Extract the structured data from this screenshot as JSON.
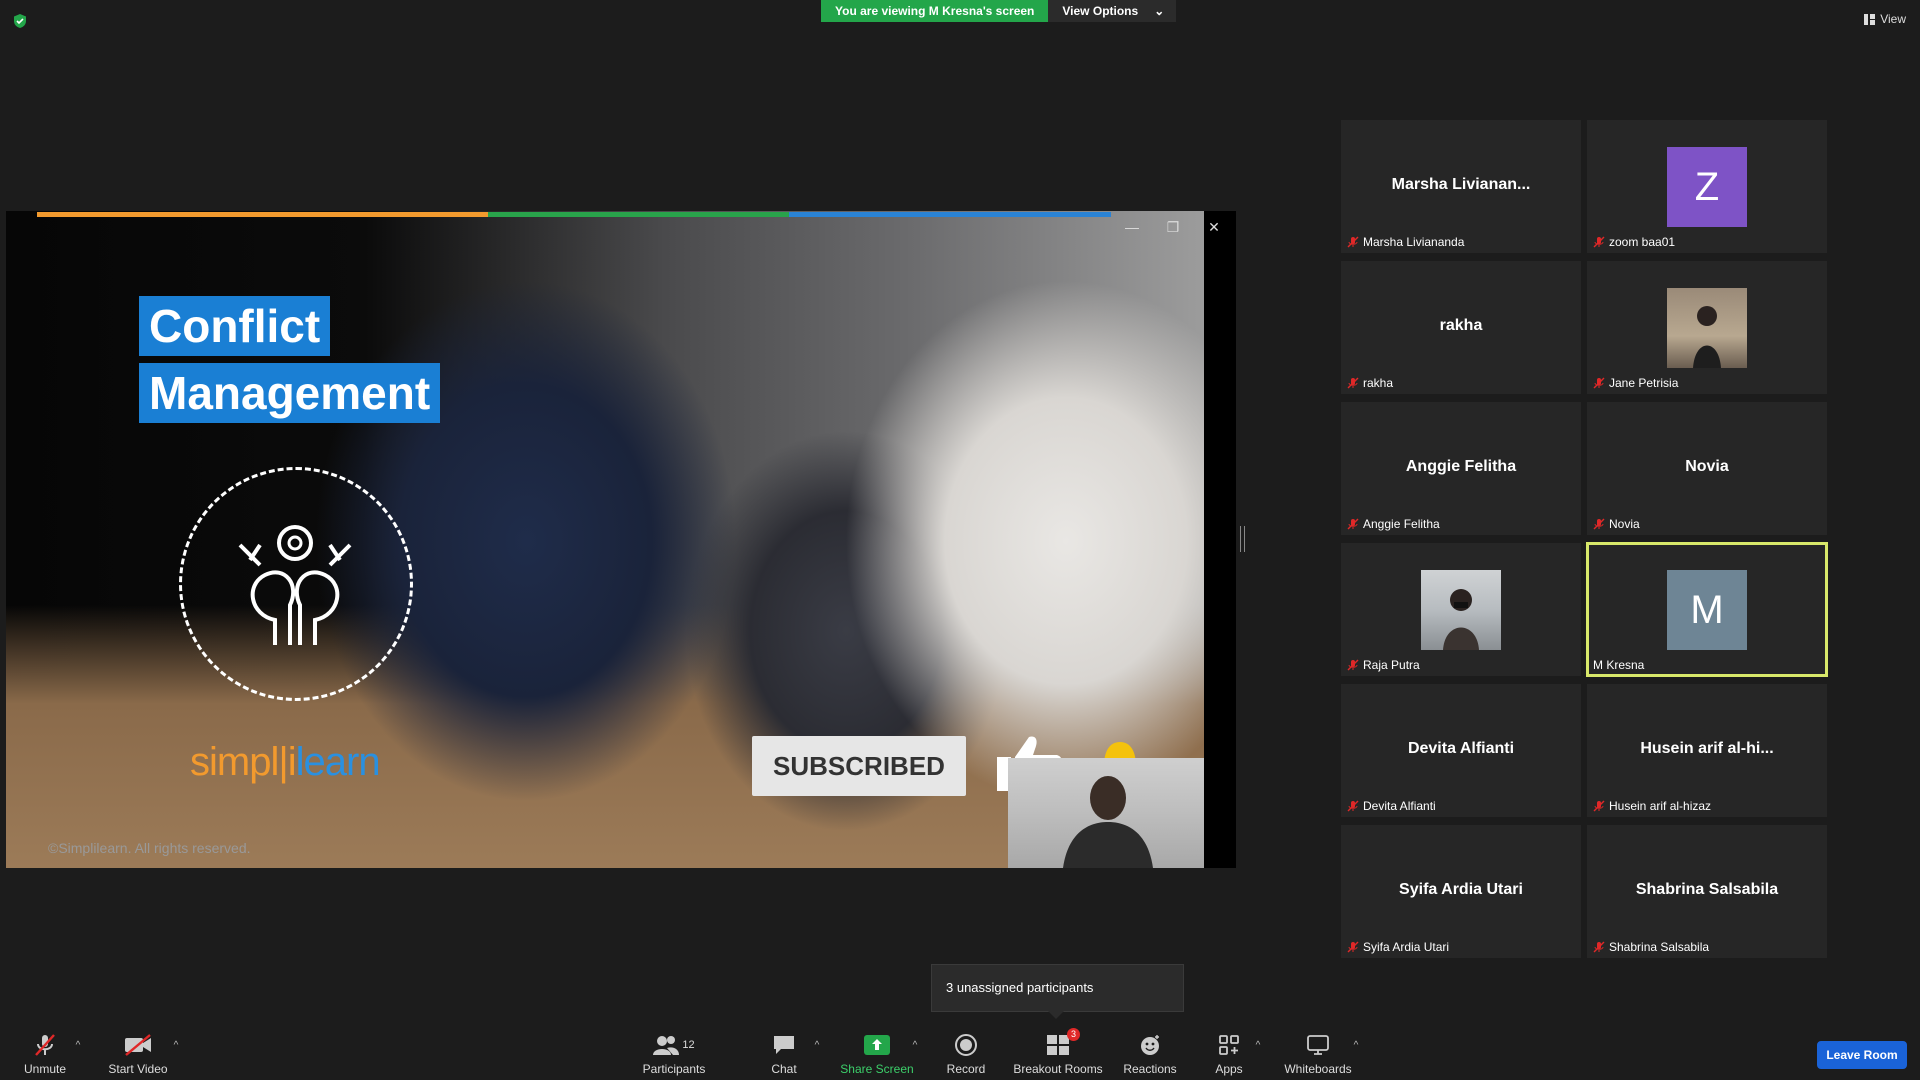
{
  "top": {
    "viewing_banner": "You are viewing M Kresna's screen",
    "view_options_label": "View Options",
    "view_label": "View"
  },
  "share": {
    "title_line1": "Conflict",
    "title_line2": "Management",
    "brand_part1": "simpl",
    "brand_part2": "learn",
    "copyright": "©Simplilearn. All rights reserved.",
    "subscribed_label": "SUBSCRIBED"
  },
  "gallery": {
    "tiles": [
      {
        "display_name": "Marsha  Livianan...",
        "label": "Marsha Liviananda",
        "avatar_letter": "",
        "avatar_color": ""
      },
      {
        "display_name": "",
        "label": "zoom baa01",
        "avatar_letter": "Z",
        "avatar_color": "#7e53c6"
      },
      {
        "display_name": "rakha",
        "label": "rakha",
        "avatar_letter": "",
        "avatar_color": ""
      },
      {
        "display_name": "",
        "label": "Jane Petrisia",
        "avatar_letter": "",
        "avatar_color": ""
      },
      {
        "display_name": "Anggie Felitha",
        "label": "Anggie Felitha",
        "avatar_letter": "",
        "avatar_color": ""
      },
      {
        "display_name": "Novia",
        "label": "Novia",
        "avatar_letter": "",
        "avatar_color": ""
      },
      {
        "display_name": "",
        "label": "Raja Putra",
        "avatar_letter": "",
        "avatar_color": ""
      },
      {
        "display_name": "",
        "label": "M Kresna",
        "avatar_letter": "M",
        "avatar_color": "#6e8595"
      },
      {
        "display_name": "Devita Alfianti",
        "label": "Devita Alfianti",
        "avatar_letter": "",
        "avatar_color": ""
      },
      {
        "display_name": "Husein arif al-hi...",
        "label": "Husein arif al-hizaz",
        "avatar_letter": "",
        "avatar_color": ""
      },
      {
        "display_name": "Syifa Ardia Utari",
        "label": "Syifa Ardia Utari",
        "avatar_letter": "",
        "avatar_color": ""
      },
      {
        "display_name": "Shabrina Salsabila",
        "label": "Shabrina Salsabila",
        "avatar_letter": "",
        "avatar_color": ""
      }
    ]
  },
  "tooltip": {
    "text": "3 unassigned participants"
  },
  "toolbar": {
    "unmute": "Unmute",
    "start_video": "Start Video",
    "participants": "Participants",
    "participants_count": "12",
    "chat": "Chat",
    "share_screen": "Share Screen",
    "record": "Record",
    "breakout_rooms": "Breakout Rooms",
    "breakout_badge": "3",
    "reactions": "Reactions",
    "apps": "Apps",
    "whiteboards": "Whiteboards",
    "leave_room": "Leave Room"
  },
  "colors": {
    "banner_green": "#23a64a",
    "leave_blue": "#1a63d8",
    "speaker_highlight": "#d8e86a",
    "muted_red": "#e02828"
  }
}
